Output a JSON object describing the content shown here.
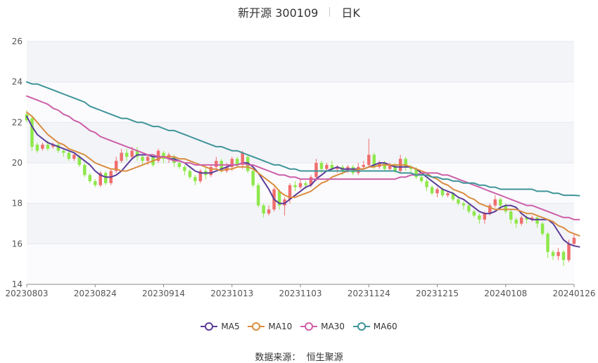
{
  "header": {
    "stock": "新开源 300109",
    "period": "日K"
  },
  "source": {
    "label": "数据来源：",
    "provider": "恒生聚源"
  },
  "legend": [
    {
      "name": "MA5",
      "color": "#5b3c99"
    },
    {
      "name": "MA10",
      "color": "#d98c3f"
    },
    {
      "name": "MA30",
      "color": "#cc5fa8"
    },
    {
      "name": "MA60",
      "color": "#3f9499"
    }
  ],
  "chart_data": {
    "type": "candlestick",
    "ylim": [
      14,
      26
    ],
    "yticks": [
      14,
      16,
      18,
      20,
      22,
      24,
      26
    ],
    "x_labels": [
      "20230803",
      "20230824",
      "20230914",
      "20231013",
      "20231103",
      "20231124",
      "20231215",
      "20240108",
      "20240126"
    ],
    "up_color": "#f06e6e",
    "down_color": "#8ee84a",
    "candles": [
      [
        22.4,
        22.1,
        22.6,
        22.0
      ],
      [
        22.2,
        20.8,
        22.3,
        20.6
      ],
      [
        20.9,
        20.6,
        21.0,
        20.5
      ],
      [
        20.7,
        20.9,
        21.0,
        20.6
      ],
      [
        20.9,
        20.7,
        21.1,
        20.6
      ],
      [
        20.8,
        20.9,
        21.0,
        20.7
      ],
      [
        20.9,
        20.6,
        21.0,
        20.5
      ],
      [
        20.6,
        20.5,
        20.7,
        20.3
      ],
      [
        20.5,
        20.2,
        20.6,
        20.1
      ],
      [
        20.2,
        20.4,
        20.5,
        20.1
      ],
      [
        20.3,
        19.9,
        20.4,
        19.8
      ],
      [
        19.9,
        19.4,
        20.0,
        19.3
      ],
      [
        19.4,
        19.1,
        19.5,
        19.0
      ],
      [
        19.1,
        18.9,
        19.2,
        18.8
      ],
      [
        18.9,
        19.5,
        19.6,
        18.8
      ],
      [
        19.5,
        19.0,
        19.6,
        18.9
      ],
      [
        19.0,
        19.6,
        19.7,
        18.9
      ],
      [
        19.6,
        20.1,
        20.3,
        19.5
      ],
      [
        20.1,
        20.5,
        20.7,
        20.0
      ],
      [
        20.5,
        20.3,
        20.7,
        20.1
      ],
      [
        20.3,
        20.6,
        20.8,
        20.2
      ],
      [
        20.6,
        20.3,
        20.8,
        20.1
      ],
      [
        20.3,
        20.1,
        20.4,
        19.9
      ],
      [
        20.1,
        20.3,
        20.4,
        19.9
      ],
      [
        20.3,
        19.9,
        20.4,
        19.8
      ],
      [
        20.1,
        20.6,
        20.7,
        20.0
      ],
      [
        20.5,
        20.2,
        20.6,
        20.0
      ],
      [
        20.2,
        20.4,
        20.5,
        20.0
      ],
      [
        20.3,
        20.0,
        20.4,
        19.8
      ],
      [
        20.0,
        19.8,
        20.1,
        19.7
      ],
      [
        19.8,
        19.6,
        19.9,
        19.4
      ],
      [
        19.6,
        19.3,
        19.7,
        19.2
      ],
      [
        19.3,
        19.1,
        19.4,
        18.9
      ],
      [
        19.1,
        19.6,
        19.7,
        19.0
      ],
      [
        19.6,
        19.4,
        19.8,
        19.2
      ],
      [
        19.4,
        19.8,
        19.9,
        19.3
      ],
      [
        19.8,
        20.1,
        20.3,
        19.7
      ],
      [
        20.1,
        19.6,
        20.2,
        19.5
      ],
      [
        19.6,
        19.8,
        20.0,
        19.5
      ],
      [
        19.8,
        20.2,
        20.3,
        19.6
      ],
      [
        20.2,
        19.9,
        20.3,
        19.8
      ],
      [
        19.9,
        20.5,
        20.6,
        19.7
      ],
      [
        20.3,
        19.6,
        20.4,
        19.5
      ],
      [
        19.6,
        18.9,
        19.7,
        18.8
      ],
      [
        18.9,
        17.9,
        19.0,
        17.8
      ],
      [
        17.9,
        17.5,
        18.0,
        17.3
      ],
      [
        17.5,
        17.7,
        17.9,
        17.4
      ],
      [
        17.7,
        18.7,
        18.8,
        17.6
      ],
      [
        18.6,
        17.9,
        18.7,
        17.7
      ],
      [
        17.9,
        18.2,
        18.3,
        17.4
      ],
      [
        18.2,
        18.9,
        19.0,
        18.0
      ],
      [
        18.9,
        18.8,
        19.1,
        18.6
      ],
      [
        18.8,
        19.0,
        19.2,
        18.7
      ],
      [
        19.0,
        18.9,
        19.1,
        18.7
      ],
      [
        18.9,
        19.3,
        19.4,
        18.8
      ],
      [
        19.3,
        20.0,
        20.2,
        19.1
      ],
      [
        20.0,
        19.7,
        20.1,
        19.5
      ],
      [
        19.7,
        19.9,
        20.0,
        19.6
      ],
      [
        19.9,
        19.7,
        20.1,
        19.6
      ],
      [
        19.7,
        19.8,
        19.9,
        19.5
      ],
      [
        19.8,
        19.6,
        19.9,
        19.4
      ],
      [
        19.6,
        19.8,
        19.9,
        19.5
      ],
      [
        19.8,
        19.5,
        19.9,
        19.4
      ],
      [
        19.5,
        19.8,
        20.0,
        19.4
      ],
      [
        19.8,
        19.9,
        20.1,
        19.7
      ],
      [
        19.9,
        20.4,
        21.2,
        19.8
      ],
      [
        20.4,
        19.8,
        20.5,
        19.7
      ],
      [
        19.8,
        20.0,
        20.1,
        19.7
      ],
      [
        20.0,
        19.7,
        20.1,
        19.6
      ],
      [
        19.7,
        19.9,
        20.0,
        19.6
      ],
      [
        19.9,
        19.6,
        20.0,
        19.5
      ],
      [
        19.6,
        20.2,
        20.4,
        19.5
      ],
      [
        20.2,
        19.8,
        20.3,
        19.6
      ],
      [
        19.8,
        19.7,
        19.9,
        19.5
      ],
      [
        19.7,
        19.3,
        19.8,
        19.2
      ],
      [
        19.3,
        19.1,
        19.4,
        19.0
      ],
      [
        19.1,
        18.8,
        19.2,
        18.6
      ],
      [
        18.8,
        18.5,
        18.9,
        18.4
      ],
      [
        18.5,
        18.7,
        18.8,
        18.3
      ],
      [
        18.7,
        18.4,
        18.8,
        18.3
      ],
      [
        18.4,
        18.5,
        18.6,
        18.3
      ],
      [
        18.5,
        18.2,
        18.6,
        18.1
      ],
      [
        18.2,
        18.0,
        18.3,
        17.9
      ],
      [
        18.0,
        17.9,
        18.1,
        17.7
      ],
      [
        17.9,
        17.6,
        18.0,
        17.5
      ],
      [
        17.6,
        17.4,
        17.7,
        17.3
      ],
      [
        17.4,
        17.2,
        17.5,
        17.0
      ],
      [
        17.2,
        17.5,
        17.6,
        17.0
      ],
      [
        17.5,
        17.9,
        18.0,
        17.4
      ],
      [
        17.9,
        18.2,
        18.4,
        17.8
      ],
      [
        18.2,
        17.9,
        18.3,
        17.7
      ],
      [
        17.9,
        17.6,
        18.0,
        17.5
      ],
      [
        17.6,
        17.2,
        17.7,
        17.0
      ],
      [
        17.2,
        17.0,
        17.3,
        16.8
      ],
      [
        17.0,
        17.3,
        17.4,
        16.9
      ],
      [
        17.3,
        17.2,
        17.4,
        17.0
      ],
      [
        17.2,
        17.3,
        17.4,
        17.1
      ],
      [
        17.3,
        17.0,
        17.4,
        16.8
      ],
      [
        17.0,
        16.5,
        17.1,
        16.4
      ],
      [
        16.5,
        15.6,
        16.6,
        15.3
      ],
      [
        15.6,
        15.4,
        15.7,
        15.2
      ],
      [
        15.4,
        15.6,
        15.8,
        15.2
      ],
      [
        15.6,
        15.2,
        15.7,
        14.9
      ],
      [
        15.2,
        16.0,
        16.2,
        15.1
      ],
      [
        16.0,
        16.3,
        16.5,
        15.9
      ]
    ],
    "series": [
      {
        "name": "MA5",
        "color": "#5b3c99",
        "values": [
          22.3,
          21.8,
          21.4,
          21.2,
          21.0,
          20.9,
          20.8,
          20.7,
          20.6,
          20.5,
          20.3,
          20.1,
          19.9,
          19.6,
          19.4,
          19.3,
          19.3,
          19.4,
          19.6,
          19.9,
          20.2,
          20.4,
          20.4,
          20.4,
          20.3,
          20.3,
          20.3,
          20.2,
          20.2,
          20.1,
          20.0,
          19.8,
          19.6,
          19.5,
          19.5,
          19.5,
          19.6,
          19.7,
          19.8,
          19.9,
          19.9,
          20.0,
          20.0,
          19.8,
          19.5,
          19.1,
          18.7,
          18.2,
          18.0,
          18.0,
          18.2,
          18.4,
          18.6,
          18.8,
          18.9,
          19.2,
          19.4,
          19.6,
          19.7,
          19.8,
          19.7,
          19.7,
          19.7,
          19.7,
          19.7,
          19.8,
          19.9,
          20.0,
          20.0,
          19.9,
          19.8,
          19.8,
          19.8,
          19.8,
          19.7,
          19.5,
          19.3,
          19.1,
          18.9,
          18.7,
          18.6,
          18.5,
          18.3,
          18.2,
          18.0,
          17.8,
          17.6,
          17.5,
          17.5,
          17.6,
          17.8,
          17.9,
          17.9,
          17.8,
          17.5,
          17.3,
          17.2,
          17.2,
          17.2,
          17.2,
          17.0,
          16.6,
          16.2,
          16.0,
          15.9,
          15.85
        ]
      },
      {
        "name": "MA10",
        "color": "#d98c3f",
        "values": [
          22.5,
          22.3,
          22.0,
          21.7,
          21.4,
          21.2,
          21.0,
          20.9,
          20.7,
          20.6,
          20.5,
          20.4,
          20.2,
          20.0,
          19.9,
          19.8,
          19.7,
          19.7,
          19.6,
          19.6,
          19.7,
          19.8,
          19.9,
          20.0,
          20.1,
          20.2,
          20.3,
          20.3,
          20.3,
          20.2,
          20.2,
          20.1,
          20.0,
          19.9,
          19.8,
          19.7,
          19.7,
          19.6,
          19.7,
          19.7,
          19.8,
          19.8,
          19.8,
          19.7,
          19.5,
          19.3,
          19.1,
          18.9,
          18.6,
          18.4,
          18.3,
          18.3,
          18.4,
          18.5,
          18.6,
          18.8,
          19.0,
          19.1,
          19.3,
          19.4,
          19.5,
          19.6,
          19.6,
          19.7,
          19.7,
          19.8,
          19.8,
          19.9,
          19.9,
          19.9,
          19.9,
          19.9,
          19.9,
          19.8,
          19.7,
          19.6,
          19.5,
          19.3,
          19.2,
          19.0,
          18.9,
          18.7,
          18.6,
          18.5,
          18.3,
          18.2,
          18.0,
          17.9,
          17.8,
          17.7,
          17.7,
          17.7,
          17.7,
          17.7,
          17.6,
          17.5,
          17.5,
          17.4,
          17.3,
          17.2,
          17.1,
          16.9,
          16.8,
          16.6,
          16.5,
          16.4
        ]
      },
      {
        "name": "MA30",
        "color": "#cc5fa8",
        "values": [
          23.3,
          23.2,
          23.1,
          23.0,
          22.9,
          22.7,
          22.6,
          22.4,
          22.3,
          22.1,
          22.0,
          21.8,
          21.6,
          21.5,
          21.3,
          21.2,
          21.1,
          21.0,
          20.9,
          20.8,
          20.7,
          20.6,
          20.5,
          20.4,
          20.4,
          20.3,
          20.3,
          20.2,
          20.1,
          20.1,
          20.0,
          20.0,
          19.9,
          19.9,
          19.9,
          19.9,
          19.9,
          19.9,
          19.9,
          19.9,
          19.9,
          20.0,
          19.9,
          19.9,
          19.8,
          19.7,
          19.6,
          19.5,
          19.4,
          19.4,
          19.3,
          19.3,
          19.2,
          19.2,
          19.2,
          19.2,
          19.2,
          19.2,
          19.2,
          19.2,
          19.2,
          19.2,
          19.2,
          19.2,
          19.2,
          19.2,
          19.2,
          19.2,
          19.2,
          19.2,
          19.2,
          19.3,
          19.3,
          19.4,
          19.4,
          19.5,
          19.5,
          19.5,
          19.5,
          19.4,
          19.4,
          19.3,
          19.2,
          19.1,
          19.0,
          18.9,
          18.8,
          18.7,
          18.6,
          18.5,
          18.4,
          18.3,
          18.2,
          18.1,
          18.0,
          17.9,
          17.9,
          17.8,
          17.7,
          17.6,
          17.5,
          17.4,
          17.3,
          17.3,
          17.2,
          17.2
        ]
      },
      {
        "name": "MA60",
        "color": "#3f9499",
        "values": [
          24.0,
          23.9,
          23.9,
          23.8,
          23.7,
          23.6,
          23.5,
          23.4,
          23.3,
          23.2,
          23.1,
          23.0,
          22.8,
          22.7,
          22.6,
          22.5,
          22.4,
          22.3,
          22.2,
          22.2,
          22.1,
          22.0,
          22.0,
          21.9,
          21.8,
          21.8,
          21.7,
          21.6,
          21.6,
          21.5,
          21.4,
          21.3,
          21.2,
          21.1,
          21.0,
          20.9,
          20.8,
          20.8,
          20.7,
          20.6,
          20.6,
          20.5,
          20.4,
          20.3,
          20.2,
          20.1,
          20.0,
          19.9,
          19.9,
          19.8,
          19.7,
          19.7,
          19.6,
          19.6,
          19.6,
          19.6,
          19.6,
          19.6,
          19.6,
          19.6,
          19.6,
          19.6,
          19.6,
          19.6,
          19.6,
          19.6,
          19.6,
          19.6,
          19.6,
          19.6,
          19.6,
          19.5,
          19.5,
          19.5,
          19.4,
          19.4,
          19.4,
          19.3,
          19.3,
          19.2,
          19.2,
          19.1,
          19.1,
          19.0,
          19.0,
          19.0,
          18.9,
          18.9,
          18.8,
          18.8,
          18.7,
          18.7,
          18.7,
          18.7,
          18.7,
          18.7,
          18.7,
          18.6,
          18.6,
          18.6,
          18.5,
          18.5,
          18.4,
          18.4,
          18.4,
          18.38
        ]
      }
    ]
  }
}
